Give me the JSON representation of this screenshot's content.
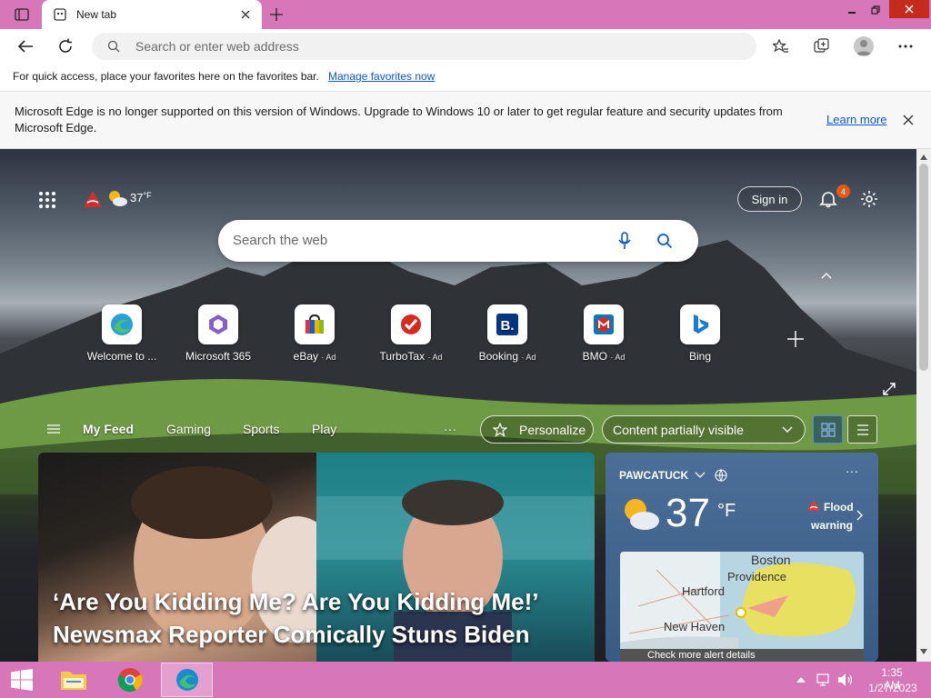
{
  "browser": {
    "tab_title": "New tab",
    "address_placeholder": "Search or enter web address",
    "favorites_bar_text": "For quick access, place your favorites here on the favorites bar.",
    "favorites_bar_link": "Manage favorites now",
    "info_message": "Microsoft Edge is no longer supported on this version of Windows. Upgrade to Windows 10 or later to get regular feature and security updates from Microsoft Edge.",
    "info_link": "Learn more"
  },
  "newtab": {
    "weather_temp": "37",
    "weather_unit": "°F",
    "sign_in": "Sign in",
    "notification_count": "4",
    "search_placeholder": "Search the web",
    "quick_links": [
      {
        "label": "Welcome to ...",
        "ad": ""
      },
      {
        "label": "Microsoft 365",
        "ad": ""
      },
      {
        "label": "eBay",
        "ad": "· Ad"
      },
      {
        "label": "TurboTax",
        "ad": "· Ad"
      },
      {
        "label": "Booking",
        "ad": "· Ad"
      },
      {
        "label": "BMO",
        "ad": "· Ad"
      },
      {
        "label": "Bing",
        "ad": ""
      }
    ],
    "feed_nav": [
      "My Feed",
      "Gaming",
      "Sports",
      "Play"
    ],
    "more": "···",
    "personalize": "Personalize",
    "content_visibility": "Content partially visible",
    "headline": "‘Are You Kidding Me? Are You Kidding Me!’ Newsmax Reporter Comically Stuns Biden",
    "weather_card": {
      "location": "PAWCATUCK",
      "temp": "37",
      "unit": "°F",
      "alert_line1": "Flood",
      "alert_line2": "warning",
      "map_places": [
        "Boston",
        "Providence",
        "Hartford",
        "New Haven"
      ],
      "alert_details": "Check more alert details"
    }
  },
  "taskbar": {
    "time": "1:35 AM",
    "date": "1/27/2023"
  },
  "colors": {
    "titlebar": "#d777b9",
    "link": "#0b57d0"
  }
}
